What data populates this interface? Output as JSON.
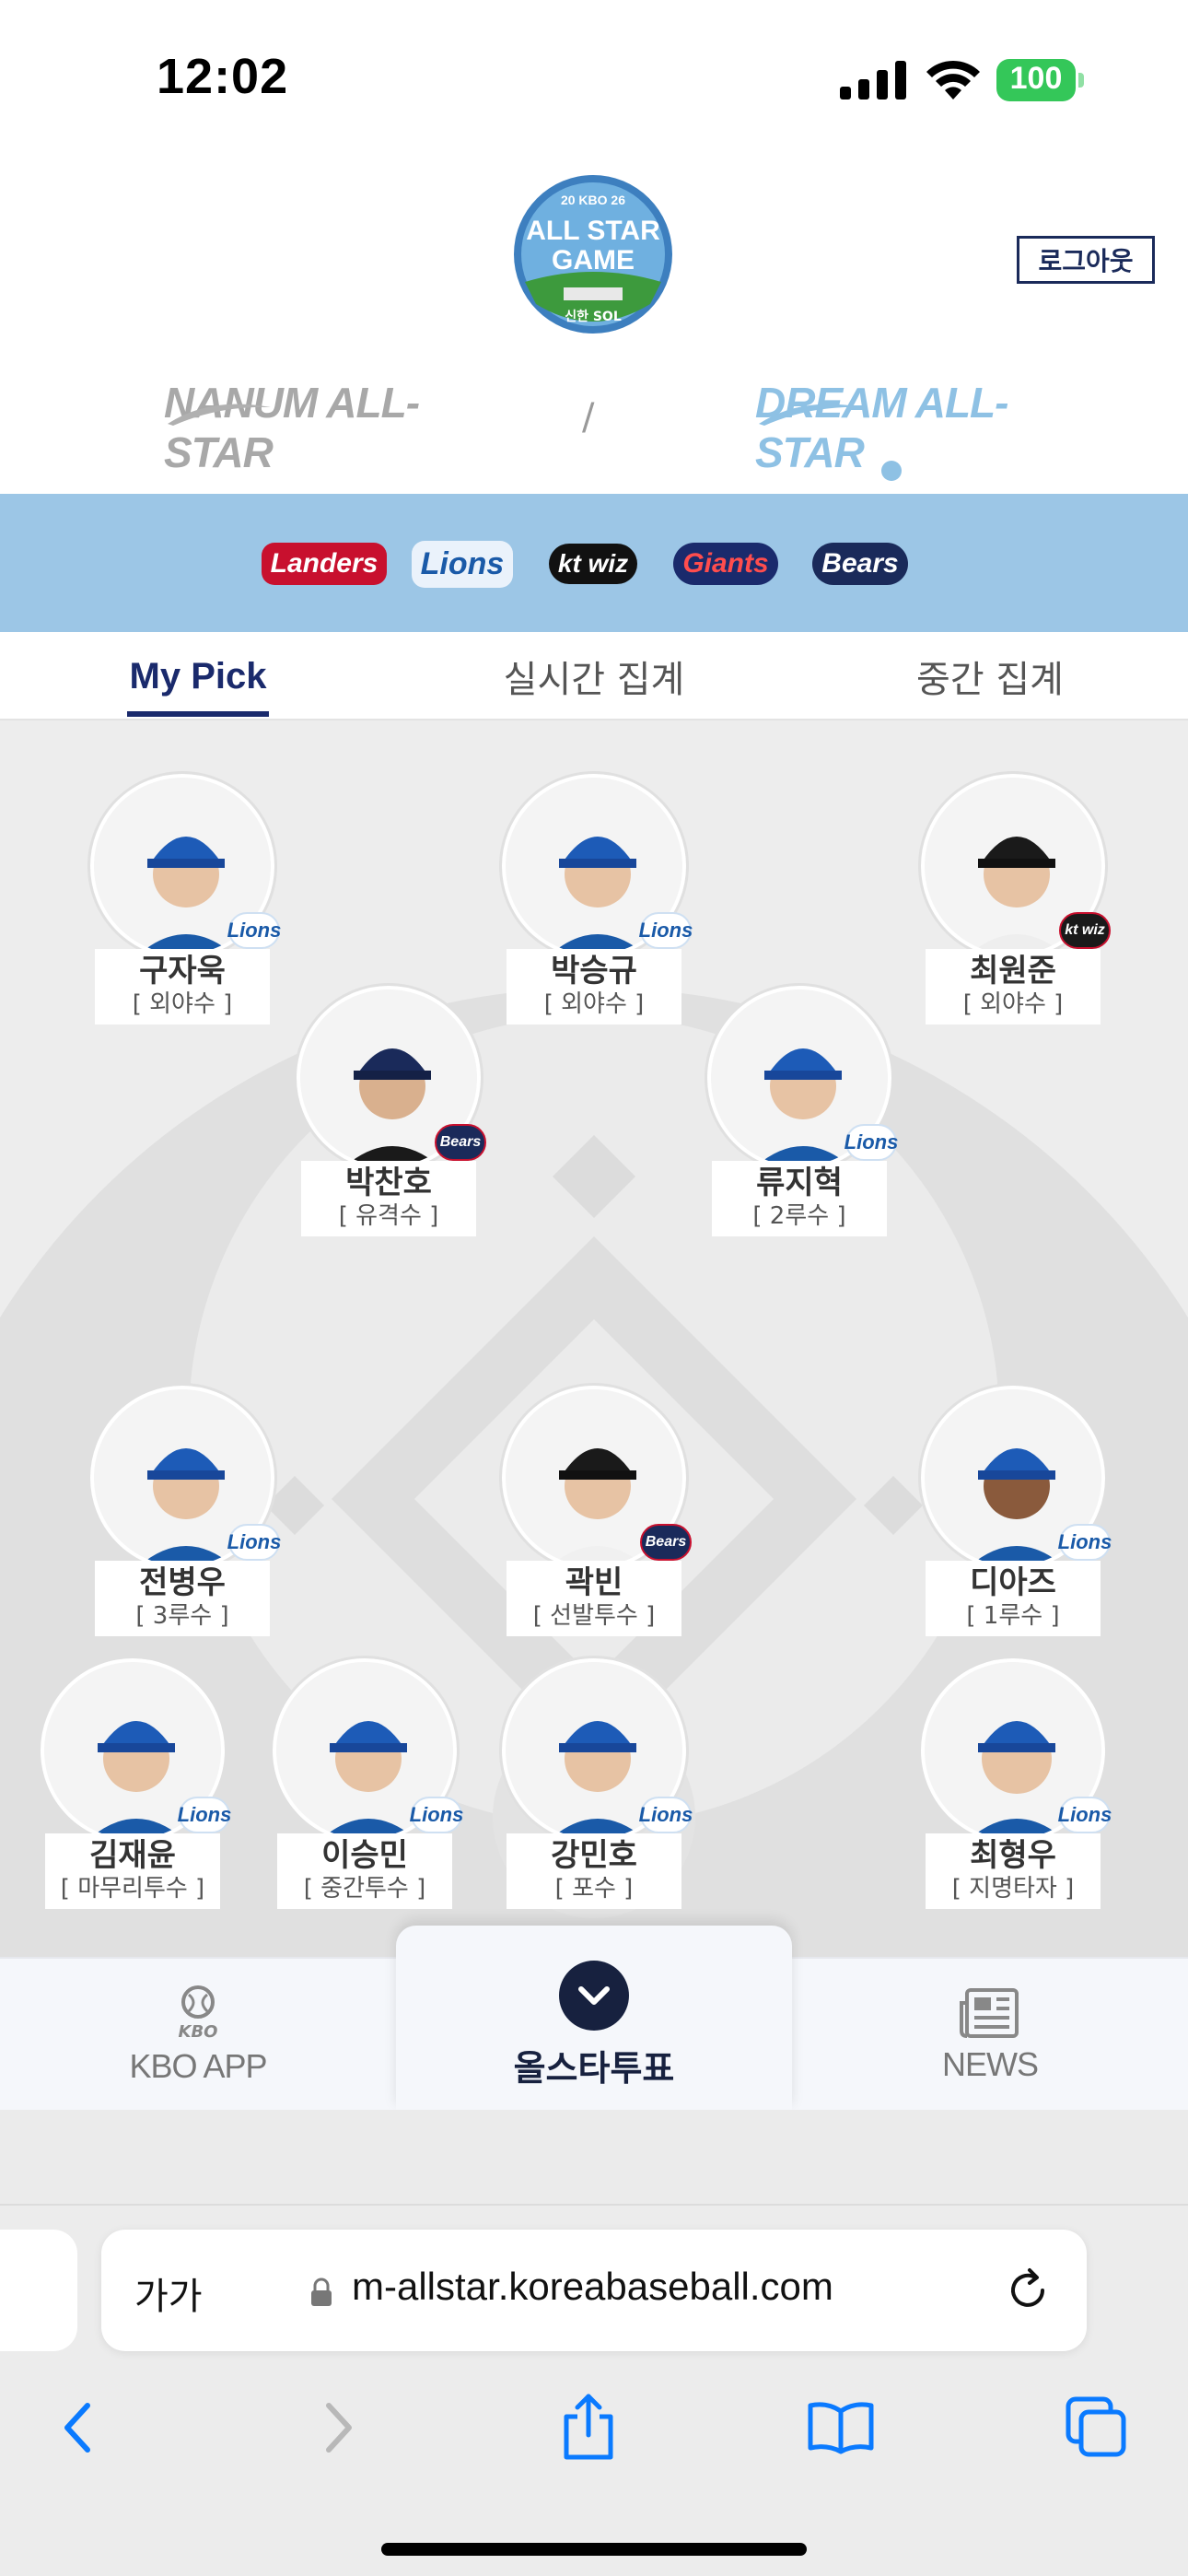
{
  "status_bar": {
    "time": "12:02",
    "battery": "100"
  },
  "header": {
    "logo_text": "ALL STAR GAME",
    "logo_top": "20 KBO 26",
    "logo_sponsor": "신한 SOL",
    "logout_label": "로그아웃"
  },
  "leagues": {
    "nanum": "NANUM ALL-STAR",
    "divider": "/",
    "dream": "DREAM ALL-STAR"
  },
  "teams": [
    {
      "name": "Landers",
      "color": "#c8102e"
    },
    {
      "name": "Lions",
      "color": "#1a5aa8"
    },
    {
      "name": "kt wiz",
      "color": "#111111"
    },
    {
      "name": "Giants",
      "color": "#c8102e"
    },
    {
      "name": "Bears",
      "color": "#1a2a5a"
    }
  ],
  "tabs": {
    "mypick": "My Pick",
    "live": "실시간 집계",
    "mid": "중간 집계"
  },
  "players": [
    {
      "name": "구자욱",
      "position": "[ 외야수 ]",
      "team": "Lions"
    },
    {
      "name": "박승규",
      "position": "[ 외야수 ]",
      "team": "Lions"
    },
    {
      "name": "최원준",
      "position": "[ 외야수 ]",
      "team": "kt wiz"
    },
    {
      "name": "박찬호",
      "position": "[ 유격수 ]",
      "team": "Bears"
    },
    {
      "name": "류지혁",
      "position": "[ 2루수 ]",
      "team": "Lions"
    },
    {
      "name": "전병우",
      "position": "[ 3루수 ]",
      "team": "Lions"
    },
    {
      "name": "곽빈",
      "position": "[ 선발투수 ]",
      "team": "Bears"
    },
    {
      "name": "디아즈",
      "position": "[ 1루수 ]",
      "team": "Lions"
    },
    {
      "name": "김재윤",
      "position": "[ 마무리투수 ]",
      "team": "Lions"
    },
    {
      "name": "이승민",
      "position": "[ 중간투수 ]",
      "team": "Lions"
    },
    {
      "name": "강민호",
      "position": "[ 포수 ]",
      "team": "Lions"
    },
    {
      "name": "최형우",
      "position": "[ 지명타자 ]",
      "team": "Lions"
    }
  ],
  "bottom_nav": {
    "kbo_small": "KBO",
    "kbo": "KBO APP",
    "vote": "올스타투표",
    "news": "NEWS"
  },
  "browser": {
    "aa": "가가",
    "url": "m-allstar.koreabaseball.com"
  }
}
